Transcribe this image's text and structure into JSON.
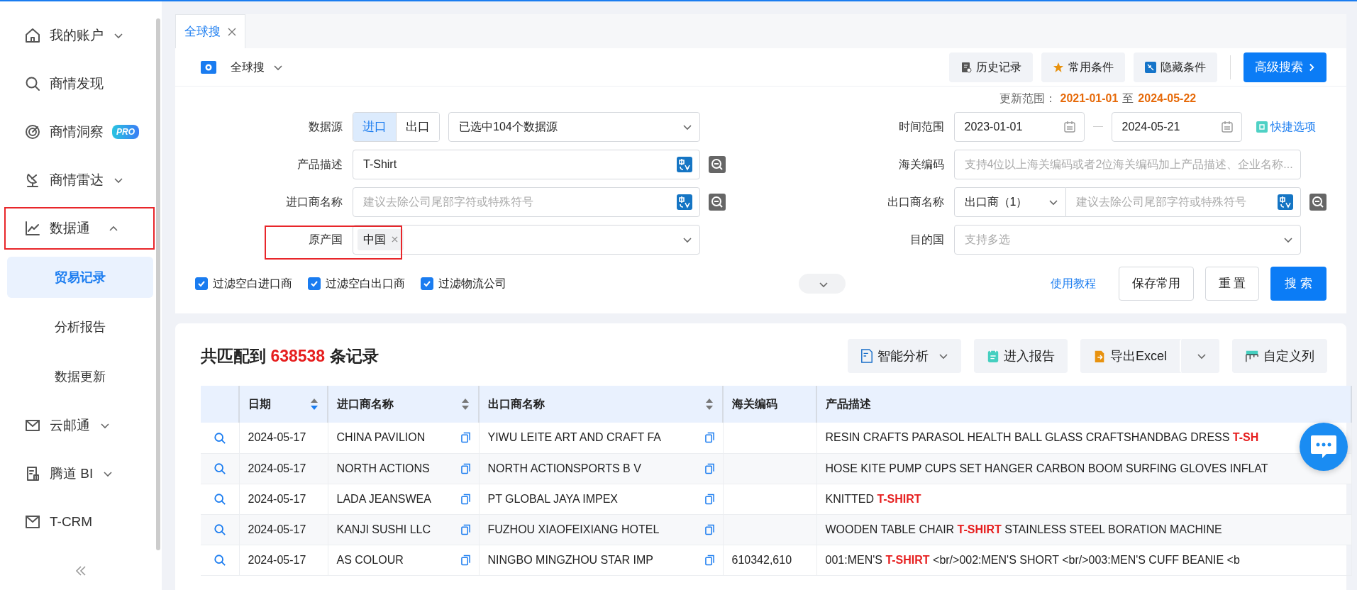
{
  "sidebar": {
    "items": [
      {
        "label": "我的账户",
        "expanded": false,
        "highlighted": false
      },
      {
        "label": "商情发现",
        "highlighted": false
      },
      {
        "label": "商情洞察",
        "badge": "PRO",
        "highlighted": false
      },
      {
        "label": "商情雷达",
        "expanded": false,
        "highlighted": false
      },
      {
        "label": "数据通",
        "expanded": true,
        "highlighted": true,
        "children": [
          {
            "label": "贸易记录",
            "selected": true
          },
          {
            "label": "分析报告",
            "selected": false
          },
          {
            "label": "数据更新",
            "selected": false
          }
        ]
      },
      {
        "label": "云邮通",
        "expanded": false,
        "highlighted": false
      },
      {
        "label": "腾道 BI",
        "expanded": false,
        "highlighted": false
      },
      {
        "label": "T-CRM",
        "highlighted": false
      }
    ]
  },
  "tabs": [
    {
      "label": "全球搜",
      "selected": true
    }
  ],
  "toolbar": {
    "scope": "全球搜",
    "buttons": [
      {
        "label": "历史记录",
        "kind": "default"
      },
      {
        "label": "常用条件",
        "kind": "default"
      },
      {
        "label": "隐藏条件",
        "kind": "default"
      },
      {
        "label": "高级搜索",
        "kind": "primary"
      }
    ]
  },
  "update_range": {
    "label": "更新范围：",
    "from": "2021-01-01",
    "separator": "至",
    "to": "2024-05-22"
  },
  "form": {
    "left": [
      {
        "kind": "source",
        "label": "数据源",
        "options": [
          {
            "label": "进口",
            "selected": true
          },
          {
            "label": "出口",
            "selected": false
          }
        ],
        "value": "已选中104个数据源",
        "highlighted": false
      },
      {
        "kind": "text",
        "label": "产品描述",
        "value": "T-Shirt",
        "highlighted": false
      },
      {
        "kind": "text",
        "label": "进口商名称",
        "placeholder": "建议去除公司尾部字符或特殊符号",
        "highlighted": false
      },
      {
        "kind": "tags",
        "label": "原产国",
        "tags": [
          "中国"
        ],
        "highlighted": true
      }
    ],
    "right": [
      {
        "kind": "daterange",
        "label": "时间范围",
        "from": "2023-01-01",
        "to": "2024-05-21",
        "link": "快捷选项"
      },
      {
        "kind": "plain",
        "label": "海关编码",
        "placeholder": "支持4位以上海关编码或者2位海关编码加上产品描述、企业名称..."
      },
      {
        "kind": "prefixed",
        "label": "出口商名称",
        "prefix": "出口商（1）",
        "placeholder": "建议去除公司尾部字符或特殊符号"
      },
      {
        "kind": "select",
        "label": "目的国",
        "placeholder": "支持多选"
      }
    ]
  },
  "filters": [
    {
      "label": "过滤空白进口商",
      "checked": true
    },
    {
      "label": "过滤空白出口商",
      "checked": true
    },
    {
      "label": "过滤物流公司",
      "checked": true
    }
  ],
  "actions": {
    "link": "使用教程",
    "buttons": [
      {
        "label": "保存常用",
        "kind": "default"
      },
      {
        "label": "重 置",
        "kind": "default"
      },
      {
        "label": "搜 索",
        "kind": "primary"
      }
    ]
  },
  "results": {
    "prefix": "共匹配到",
    "count": "638538",
    "suffix": "条记录",
    "buttons": [
      {
        "label": "智能分析",
        "kind": "dropdown"
      },
      {
        "label": "进入报告",
        "kind": "plain"
      },
      {
        "label": "导出Excel",
        "kind": "split"
      },
      {
        "label": "自定义列",
        "kind": "plain"
      }
    ]
  },
  "table": {
    "columns": [
      {
        "label": "日期",
        "sort_descending": true
      },
      {
        "label": "进口商名称",
        "sort_descending": false
      },
      {
        "label": "出口商名称",
        "sort_descending": false
      },
      {
        "label": "海关编码"
      },
      {
        "label": "产品描述"
      }
    ],
    "rows": [
      {
        "date": "2024-05-17",
        "importer": "CHINA PAVILION",
        "exporter": "YIWU LEITE ART AND CRAFT FA",
        "description": "RESIN CRAFTS PARASOL HEALTH BALL GLASS CRAFTSHANDBAG DRESS **T-SH**"
      },
      {
        "date": "2024-05-17",
        "importer": "NORTH ACTIONS",
        "exporter": "NORTH ACTIONSPORTS B V",
        "description": "HOSE KITE PUMP CUPS SET HANGER CARBON BOOM SURFING GLOVES INFLAT"
      },
      {
        "date": "2024-05-17",
        "importer": "LADA JEANSWEA",
        "exporter": "PT GLOBAL JAYA IMPEX",
        "description": "KNITTED **T-SHIRT**"
      },
      {
        "date": "2024-05-17",
        "importer": "KANJI SUSHI LLC",
        "exporter": "FUZHOU XIAOFEIXIANG HOTEL",
        "description": "WOODEN TABLE CHAIR **T-SHIRT** STAINLESS STEEL BORATION MACHINE"
      },
      {
        "date": "2024-05-17",
        "importer": "AS COLOUR",
        "exporter": "NINGBO MINGZHOU STAR IMP",
        "hs_code": "610342,610",
        "description": "001:MEN'S **T-SHIRT** <br/>002:MEN'S SHORT <br/>003:MEN'S CUFF BEANIE <b"
      }
    ]
  }
}
